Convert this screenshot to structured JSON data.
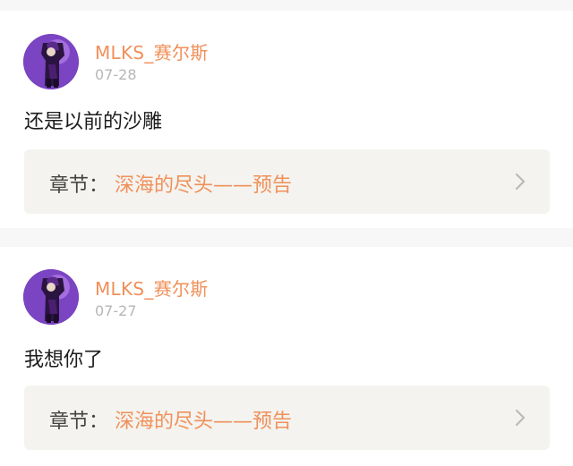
{
  "accent_color": "#f0905a",
  "posts": [
    {
      "username": "MLKS_赛尔斯",
      "date": "07-28",
      "comment": "还是以前的沙雕",
      "chapter_prefix": "章节：",
      "chapter_title": "深海的尽头——预告",
      "chevron_icon": "chevron-right-icon"
    },
    {
      "username": "MLKS_赛尔斯",
      "date": "07-27",
      "comment": "我想你了",
      "chapter_prefix": "章节：",
      "chapter_title": "深海的尽头——预告",
      "chevron_icon": "chevron-right-icon"
    }
  ]
}
